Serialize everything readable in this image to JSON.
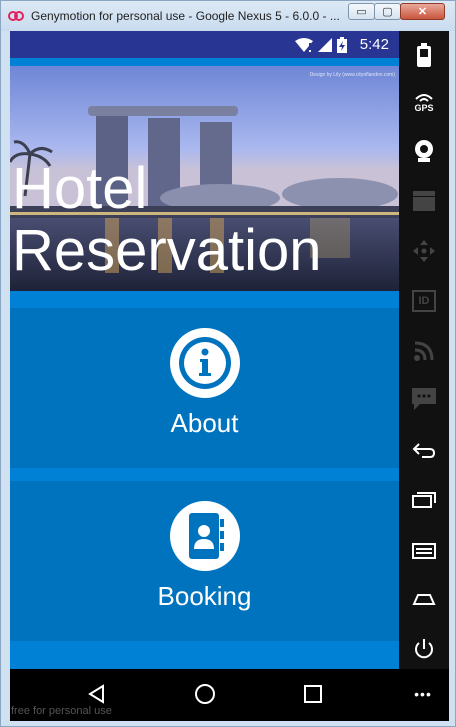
{
  "window": {
    "title": "Genymotion for personal use - Google Nexus 5 - 6.0.0 - ...",
    "minimize_glyph": "▭",
    "maximize_glyph": "▢",
    "close_glyph": "✕"
  },
  "status_bar": {
    "time": "5:42",
    "icons": [
      "wifi-icon",
      "signal-icon",
      "battery-charging-icon"
    ]
  },
  "hero": {
    "title": "Hotel Reservation",
    "credit": "Design by Lily (www.cityoflandon.com)"
  },
  "tiles": [
    {
      "label": "About",
      "icon": "info-icon"
    },
    {
      "label": "Booking",
      "icon": "contacts-book-icon"
    }
  ],
  "sidebar": {
    "items": [
      {
        "icon": "battery-icon"
      },
      {
        "icon": "gps-icon",
        "label": "GPS"
      },
      {
        "icon": "webcam-icon"
      },
      {
        "icon": "clapperboard-icon"
      },
      {
        "icon": "dpad-icon"
      },
      {
        "icon": "id-icon",
        "label": "ID"
      },
      {
        "icon": "rss-icon"
      },
      {
        "icon": "sms-icon"
      },
      {
        "icon": "back-icon"
      },
      {
        "icon": "recent-apps-icon"
      },
      {
        "icon": "menu-icon"
      },
      {
        "icon": "home-icon"
      },
      {
        "icon": "power-icon"
      }
    ]
  },
  "navbar": {
    "buttons": [
      "back-triangle-icon",
      "home-circle-icon",
      "overview-square-icon"
    ],
    "more_glyph": "•••"
  },
  "watermark": "free for personal use",
  "colors": {
    "app_blue": "#0081d6",
    "tile_blue": "#0073bf",
    "status_indigo": "#283593"
  }
}
